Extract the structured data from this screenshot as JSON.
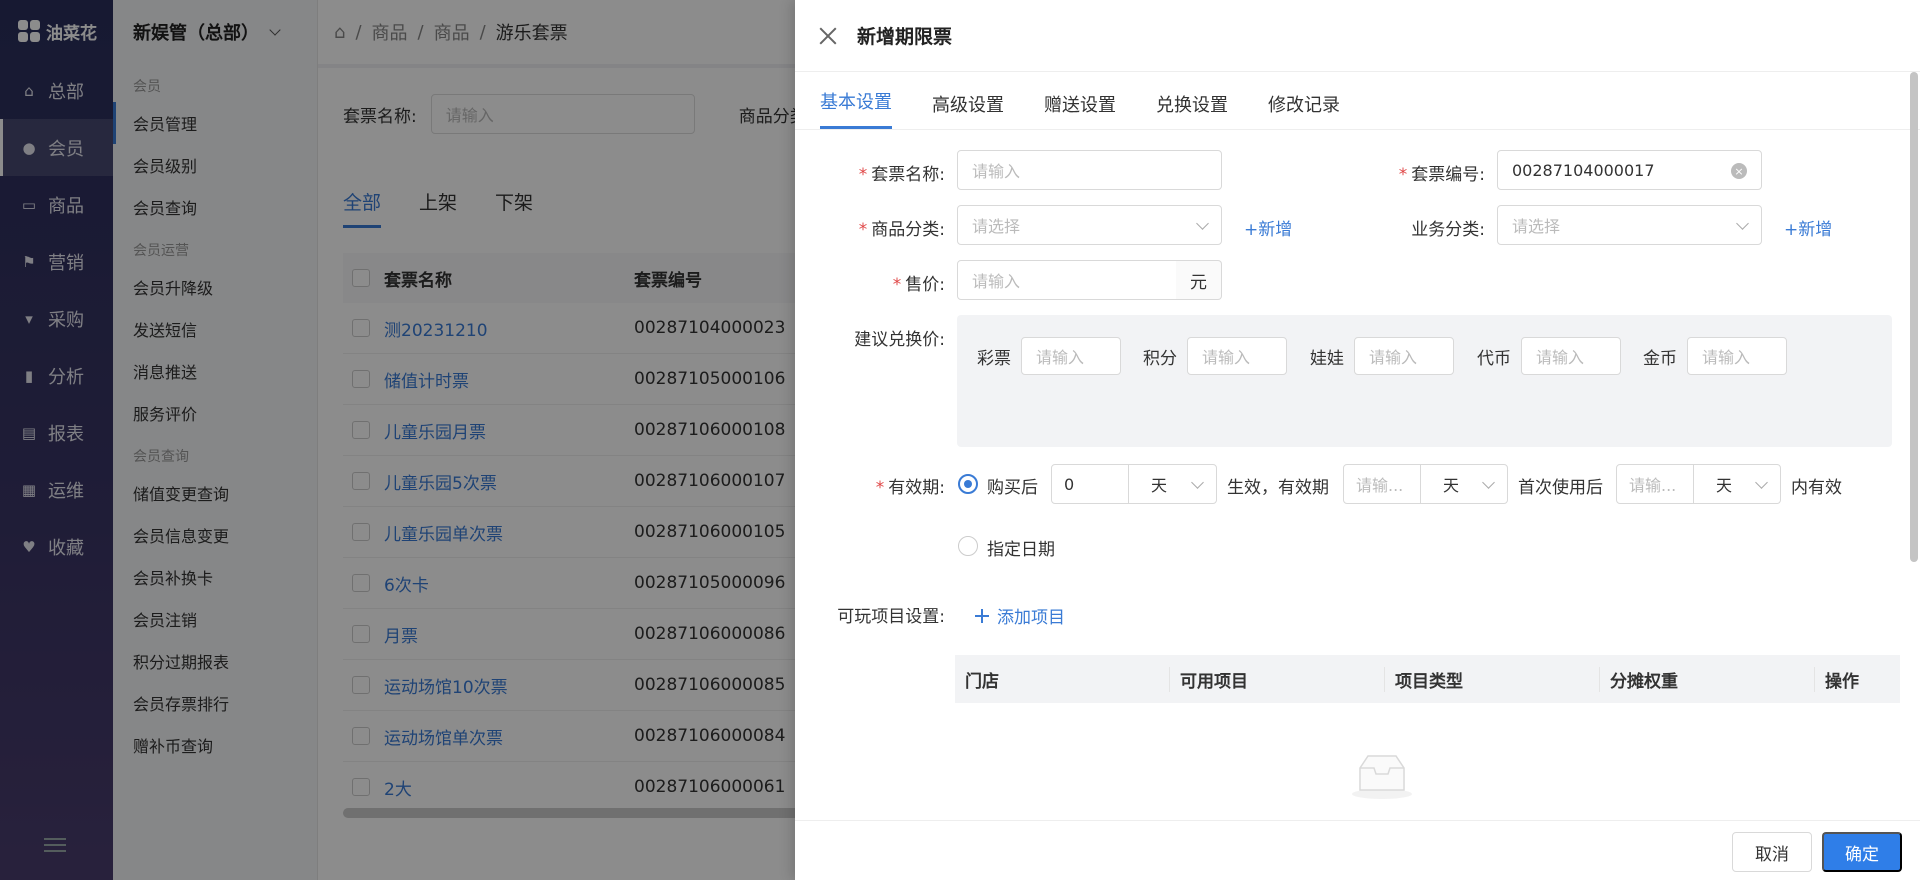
{
  "logo": {
    "text": "油菜花"
  },
  "nav": {
    "items": [
      {
        "label": "总部",
        "icon": "home-icon"
      },
      {
        "label": "会员",
        "icon": "user-icon"
      },
      {
        "label": "商品",
        "icon": "wallet-icon"
      },
      {
        "label": "营销",
        "icon": "flag-icon"
      },
      {
        "label": "采购",
        "icon": "cart-icon"
      },
      {
        "label": "分析",
        "icon": "bar-chart-icon"
      },
      {
        "label": "报表",
        "icon": "report-icon"
      },
      {
        "label": "运维",
        "icon": "calendar-icon"
      },
      {
        "label": "收藏",
        "icon": "heart-icon"
      }
    ]
  },
  "subnav": {
    "store": "新娱管（总部）",
    "groups": [
      {
        "title": "会员",
        "items": [
          "会员管理",
          "会员级别",
          "会员查询"
        ]
      },
      {
        "title": "会员运营",
        "items": [
          "会员升降级",
          "发送短信",
          "消息推送",
          "服务评价"
        ]
      },
      {
        "title": "会员查询",
        "items": [
          "储值变更查询",
          "会员信息变更",
          "会员补换卡",
          "会员注销",
          "积分过期报表",
          "会员存票排行",
          "赠补币查询"
        ]
      }
    ]
  },
  "breadcrumb": [
    "商品",
    "商品",
    "游乐套票"
  ],
  "filter": {
    "name_label": "套票名称:",
    "name_placeholder": "请输入",
    "cat_label": "商品分类"
  },
  "list_tabs": [
    "全部",
    "上架",
    "下架"
  ],
  "table": {
    "headers": [
      "套票名称",
      "套票编号"
    ],
    "rows": [
      [
        "测20231210",
        "00287104000023"
      ],
      [
        "储值计时票",
        "00287105000106"
      ],
      [
        "儿童乐园月票",
        "00287106000108"
      ],
      [
        "儿童乐园5次票",
        "00287106000107"
      ],
      [
        "儿童乐园单次票",
        "00287106000105"
      ],
      [
        "6次卡",
        "00287105000096"
      ],
      [
        "月票",
        "00287106000086"
      ],
      [
        "运动场馆10次票",
        "00287106000085"
      ],
      [
        "运动场馆单次票",
        "00287106000084"
      ],
      [
        "2大",
        "00287106000061"
      ]
    ]
  },
  "drawer": {
    "title": "新增期限票",
    "tabs": [
      "基本设置",
      "高级设置",
      "赠送设置",
      "兑换设置",
      "修改记录"
    ],
    "form": {
      "name_label": "套票名称:",
      "name_placeholder": "请输入",
      "code_label": "套票编号:",
      "code_value": "00287104000017",
      "category_label": "商品分类:",
      "category_placeholder": "请选择",
      "add_link": "+新增",
      "business_label": "业务分类:",
      "business_placeholder": "请选择",
      "price_label": "售价:",
      "price_placeholder": "请输入",
      "price_unit": "元",
      "exchange_label": "建议兑换价:",
      "exchange_items": [
        "彩票",
        "积分",
        "娃娃",
        "代币",
        "金币"
      ],
      "exchange_placeholder": "请输入",
      "validity_label": "有效期:",
      "validity_opt1": "购买后",
      "validity_days": "0",
      "unit_day": "天",
      "effective_text": "生效，有效期",
      "period_placeholder": "请输...",
      "first_use_text": "首次使用后",
      "within_text": "内有效",
      "validity_opt2": "指定日期",
      "play_label": "可玩项目设置:",
      "add_project": "添加项目",
      "project_headers": [
        "门店",
        "可用项目",
        "项目类型",
        "分摊权重",
        "操作"
      ]
    },
    "footer": {
      "cancel": "取消",
      "ok": "确定"
    }
  }
}
